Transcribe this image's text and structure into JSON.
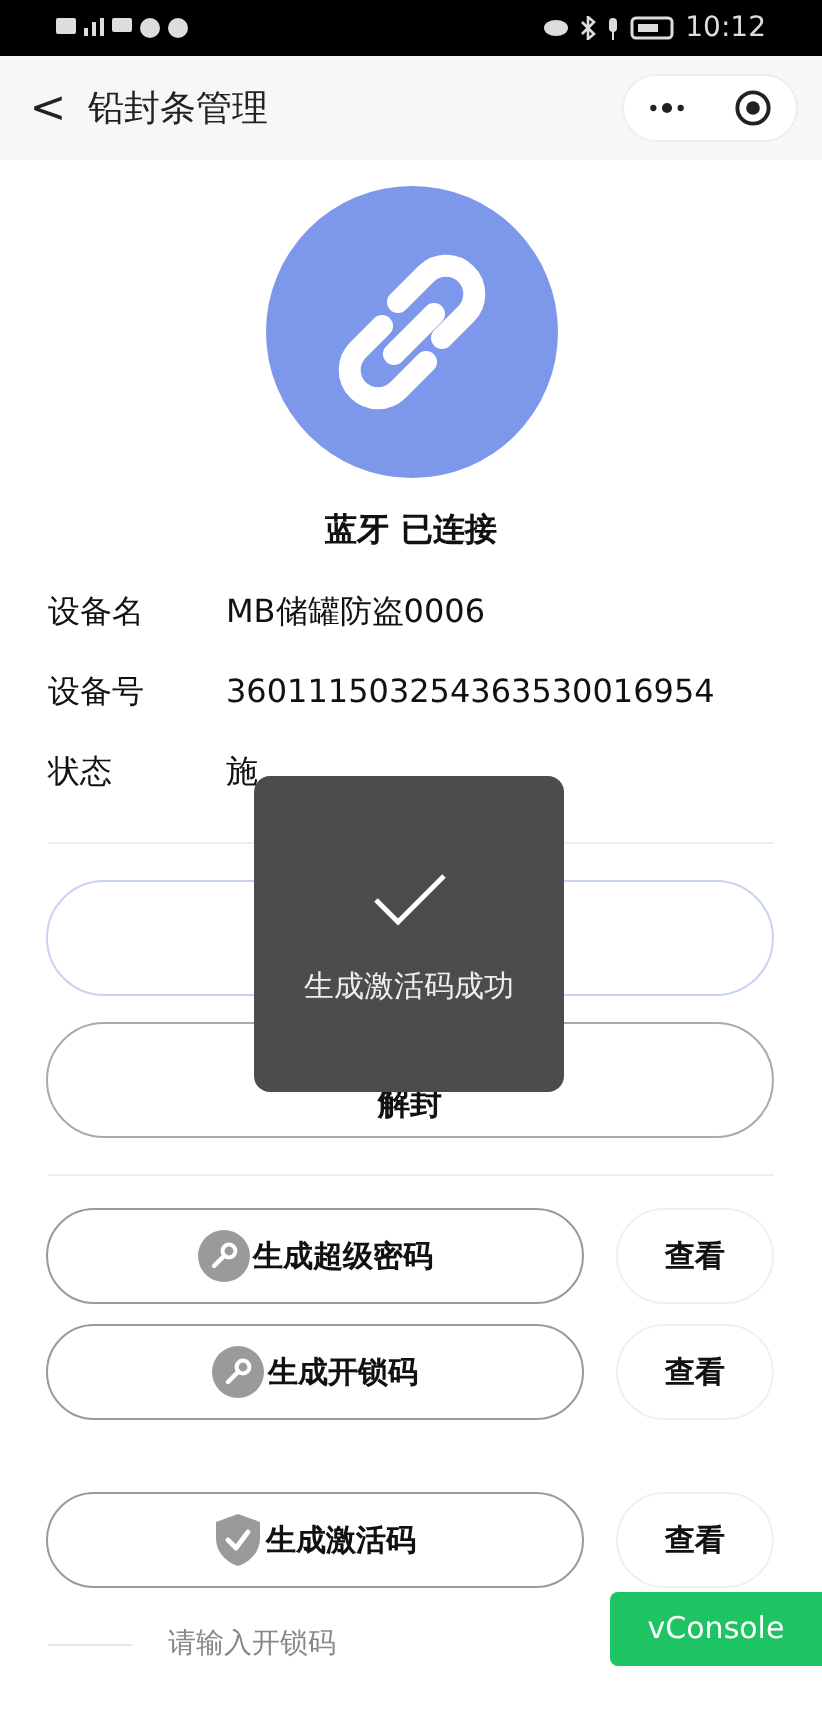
{
  "status_bar": {
    "time": "10:12"
  },
  "nav": {
    "back": "<",
    "title": "铅封条管理"
  },
  "connection": {
    "text": "蓝牙 已连接"
  },
  "info": [
    {
      "label": "设备名",
      "value": "MB储罐防盗0006"
    },
    {
      "label": "设备号",
      "value": "360111503254363530016954"
    },
    {
      "label": "状态",
      "value": "施"
    }
  ],
  "main_buttons": [
    {
      "kind": "primary"
    },
    {
      "kind": "secondary",
      "label": "解封"
    }
  ],
  "code_rows": [
    {
      "kind": "key",
      "label": "生成超级密码",
      "view": "查看"
    },
    {
      "kind": "key",
      "label": "生成开锁码",
      "view": "查看"
    },
    {
      "kind": "shield",
      "label": "生成激活码",
      "view": "查看"
    }
  ],
  "unlock_input": {
    "placeholder": "请输入开锁码"
  },
  "toast": {
    "text": "生成激活码成功"
  },
  "vconsole": {
    "label": "vConsole"
  }
}
